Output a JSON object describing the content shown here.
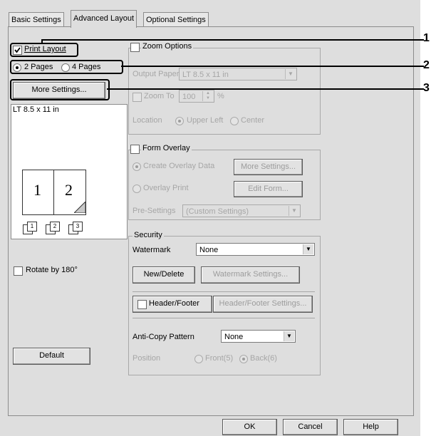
{
  "tabs": [
    {
      "label": "Basic Settings"
    },
    {
      "label": "Advanced Layout"
    },
    {
      "label": "Optional Settings"
    }
  ],
  "left": {
    "print_layout_label": "Print Layout",
    "pages_2_label": "2 Pages",
    "pages_4_label": "4 Pages",
    "more_settings_label": "More Settings...",
    "paper_label": "LT 8.5 x 11 in",
    "preview_page_1": "1",
    "preview_page_2": "2",
    "collate_1": "1",
    "collate_2": "2",
    "collate_3": "3",
    "rotate_label": "Rotate by 180°",
    "default_label": "Default"
  },
  "zoom": {
    "title": "Zoom Options",
    "output_paper_label": "Output Paper",
    "output_paper_value": "LT 8.5 x 11 in",
    "zoom_to_label": "Zoom To",
    "zoom_value": "100",
    "percent": "%",
    "location_label": "Location",
    "upper_left_label": "Upper Left",
    "center_label": "Center"
  },
  "form_overlay": {
    "title": "Form Overlay",
    "create_label": "Create Overlay Data",
    "more_settings_label": "More Settings...",
    "overlay_print_label": "Overlay Print",
    "edit_form_label": "Edit Form...",
    "presettings_label": "Pre-Settings",
    "presettings_value": "(Custom Settings)"
  },
  "security": {
    "title": "Security",
    "watermark_label": "Watermark",
    "watermark_value": "None",
    "new_delete_label": "New/Delete",
    "watermark_settings_label": "Watermark Settings...",
    "header_footer_label": "Header/Footer",
    "header_footer_settings_label": "Header/Footer Settings...",
    "anticopy_label": "Anti-Copy Pattern",
    "anticopy_value": "None",
    "position_label": "Position",
    "front_label": "Front(5)",
    "back_label": "Back(6)"
  },
  "buttons": {
    "ok": "OK",
    "cancel": "Cancel",
    "help": "Help"
  },
  "callouts": [
    "1",
    "2",
    "3"
  ]
}
